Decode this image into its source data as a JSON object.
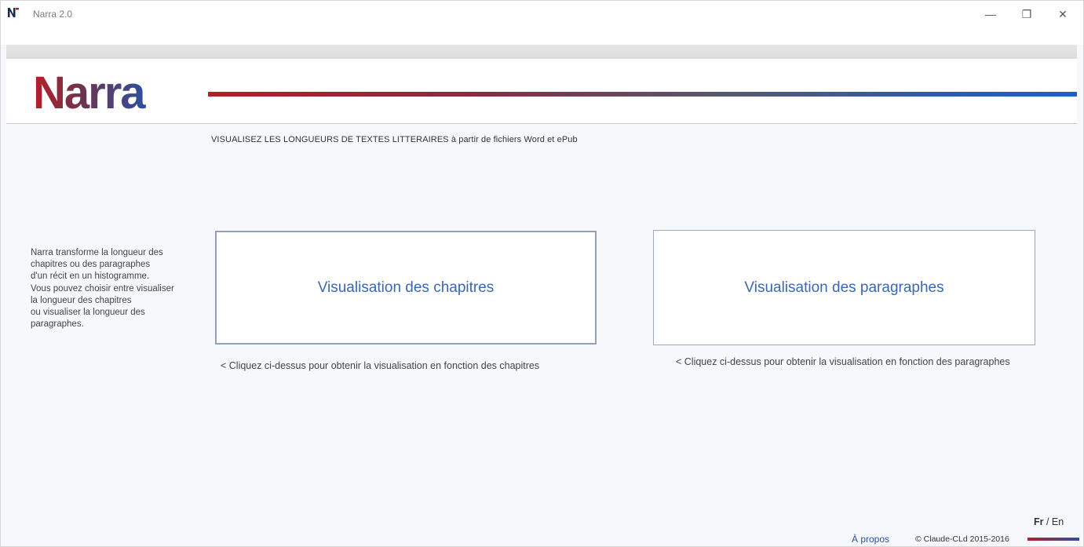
{
  "window": {
    "title": "Narra 2.0",
    "controls": {
      "minimize": "—",
      "maximize": "❐",
      "close": "✕"
    }
  },
  "header": {
    "logo_text": "Narra",
    "brand_colors": {
      "red": "#b41f27",
      "blue": "#2d5bb0"
    }
  },
  "tagline": "VISUALISEZ LES LONGUEURS DE TEXTES LITTERAIRES à partir de fichiers Word et ePub",
  "intro_lines": [
    "Narra transforme la longueur des",
    "chapitres ou des paragraphes",
    "d'un récit en un histogramme.",
    "Vous pouvez choisir entre visualiser",
    "la longueur des chapitres",
    "ou visualiser la longueur des",
    "paragraphes."
  ],
  "buttons": {
    "chapitres": "Visualisation des chapitres",
    "paragraphes": "Visualisation des paragraphes"
  },
  "hints": {
    "chapitres": "< Cliquez ci-dessus pour obtenir la visualisation en fonction des chapitres",
    "paragraphes": "< Cliquez ci-dessus pour obtenir la visualisation en fonction des paragraphes"
  },
  "footer": {
    "lang_fr": "Fr",
    "lang_sep": " / ",
    "lang_en": "En",
    "apropos": "À propos",
    "copyright": "© Claude-CLd 2015-2016"
  }
}
